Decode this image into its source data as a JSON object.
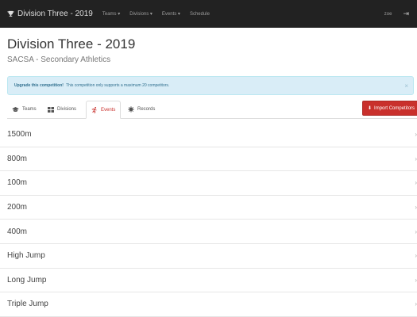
{
  "navbar": {
    "brand_icon": "trophy-icon",
    "brand": "Division Three - 2019",
    "links": [
      "Teams ▾",
      "Divisions ▾",
      "Events ▾",
      "Schedule"
    ],
    "user": "zoe",
    "signout_icon": "sign-out-icon"
  },
  "header": {
    "title": "Division Three - 2019",
    "subtitle": "SACSA - Secondary Athletics"
  },
  "alert": {
    "strong": "Upgrade this competition!",
    "text": "This competition only supports a maximum 20 competitors.",
    "close": "×"
  },
  "tabs": [
    {
      "label": "Teams",
      "icon": "graduation-cap-icon"
    },
    {
      "label": "Divisions",
      "icon": "grid-icon"
    },
    {
      "label": "Events",
      "icon": "runner-icon",
      "active": true
    },
    {
      "label": "Records",
      "icon": "medal-icon"
    }
  ],
  "import_button": {
    "label": "Import Competitors",
    "icon": "download-icon"
  },
  "events": [
    "1500m",
    "800m",
    "100m",
    "200m",
    "400m",
    "High Jump",
    "Long Jump",
    "Triple Jump"
  ],
  "colors": {
    "navbar": "#222222",
    "accent": "#c9302c",
    "alert_bg": "#d9edf7",
    "alert_text": "#31708f"
  }
}
